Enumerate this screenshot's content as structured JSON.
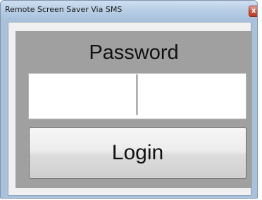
{
  "window": {
    "title": "Remote Screen Saver Via SMS",
    "close_glyph": "x",
    "accent_color": "#a9c1da"
  },
  "form": {
    "password_label": "Password",
    "password_value": "",
    "login_label": "Login"
  },
  "icons": {
    "close": "close-icon"
  }
}
